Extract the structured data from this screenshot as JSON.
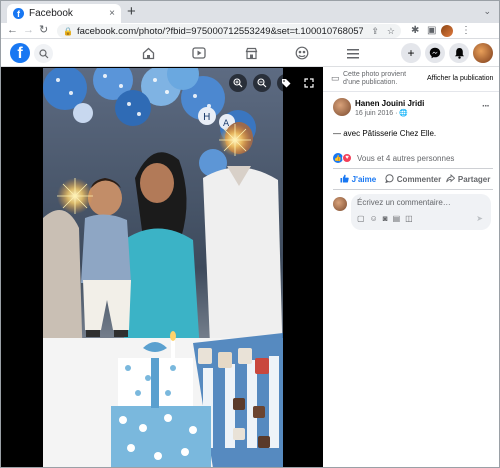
{
  "browser": {
    "tab_title": "Facebook",
    "tab_close": "×",
    "new_tab": "+",
    "url": "facebook.com/photo/?fbid=975000712553249&set=t.100010768057678",
    "colors": {
      "tab_bg": "#ffffff",
      "strip_bg": "#dee1e6"
    }
  },
  "fb_header": {
    "logo_letter": "f",
    "brand_color": "#1877f2"
  },
  "photo_tools": [
    "zoom-in-icon",
    "zoom-out-icon",
    "tag-icon",
    "fullscreen-icon"
  ],
  "panel": {
    "notice_text": "Cette photo provient d'une publication.",
    "notice_link": "Afficher la publication",
    "poster_name": "Hanen Jouini Jridi",
    "post_date": "16 juin 2016 · ",
    "more_label": "···",
    "caption": "— avec Pâtisserie Chez Elle.",
    "reactions_text": "Vous et 4 autres personnes",
    "actions": {
      "like": "J'aime",
      "comment": "Commenter",
      "share": "Partager"
    },
    "comment_placeholder": "Écrivez un commentaire…"
  }
}
